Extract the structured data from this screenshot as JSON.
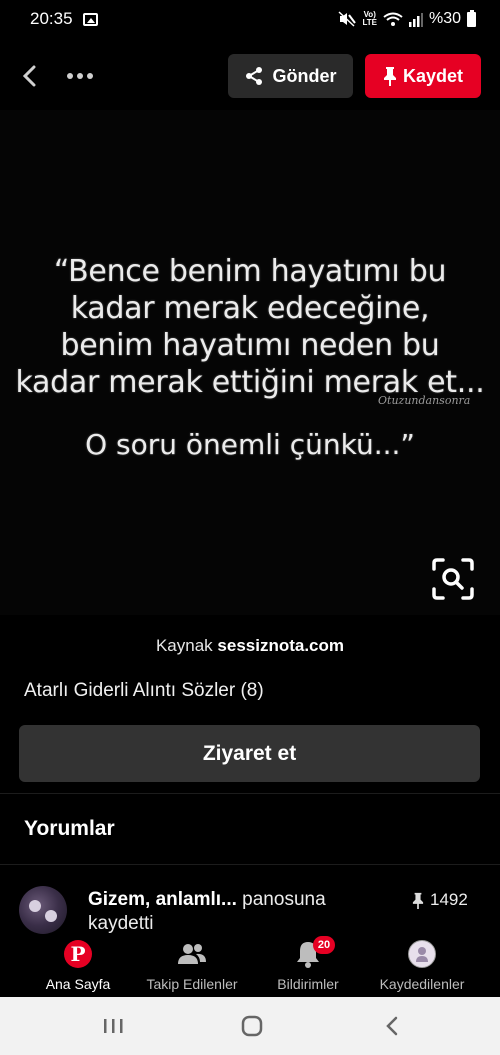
{
  "status_bar": {
    "time": "20:35",
    "volte_top": "Vo)",
    "volte_bottom": "LTE",
    "battery": "%30"
  },
  "header": {
    "share_label": "Gönder",
    "save_label": "Kaydet"
  },
  "pin": {
    "quote_lines": [
      "“Bence benim hayatımı bu",
      "kadar merak edeceğine,",
      "benim hayatımı neden bu",
      "kadar merak ettiğini merak et..."
    ],
    "watermark": "Otuzundansonra",
    "quote_tail": "O soru önemli çünkü...”",
    "source_prefix": "Kaynak",
    "source_domain": "sessiznota.com",
    "title": "Atarlı Giderli Alıntı Sözler (8)",
    "visit_label": "Ziyaret et"
  },
  "comments": {
    "title": "Yorumlar"
  },
  "activity": {
    "user": "Gizem, anlamlı...",
    "action_suffix": "panosuna",
    "action_line2": "kaydetti",
    "save_count": "1492"
  },
  "bottom_nav": {
    "items": [
      {
        "label": "Ana Sayfa",
        "icon": "pinterest-logo-icon",
        "active": true
      },
      {
        "label": "Takip Edilenler",
        "icon": "people-icon"
      },
      {
        "label": "Bildirimler",
        "icon": "bell-icon",
        "badge": "20"
      },
      {
        "label": "Kaydedilenler",
        "icon": "profile-avatar-icon"
      }
    ]
  },
  "colors": {
    "accent": "#e60023",
    "background": "#000000",
    "button_dark": "#333333"
  }
}
